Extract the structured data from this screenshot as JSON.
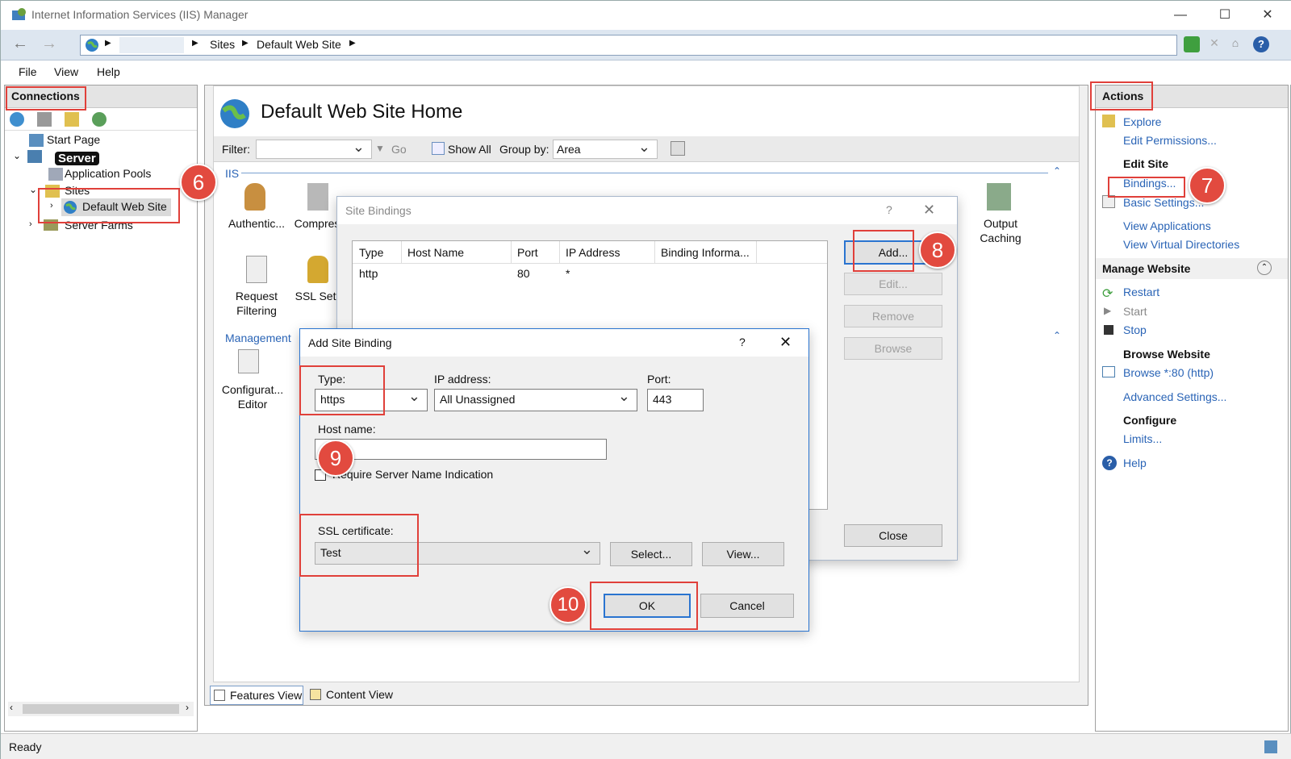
{
  "window": {
    "title": "Internet Information Services (IIS) Manager"
  },
  "address": {
    "crumbs": [
      "Sites",
      "Default Web Site"
    ]
  },
  "menu": [
    "File",
    "View",
    "Help"
  ],
  "connections": {
    "header": "Connections",
    "tree": {
      "start_page": "Start Page",
      "server": "Server",
      "app_pools": "Application Pools",
      "sites": "Sites",
      "default_site": "Default Web Site",
      "server_farms": "Server Farms"
    }
  },
  "center": {
    "title": "Default Web Site Home",
    "filter": {
      "label": "Filter:",
      "go": "Go",
      "show_all": "Show All",
      "group_by_label": "Group by:",
      "group_by_value": "Area"
    },
    "sections": {
      "iis": "IIS",
      "management": "Management"
    },
    "features": [
      {
        "label1": "Authentic...",
        "label2": ""
      },
      {
        "label1": "Compres",
        "label2": ""
      },
      {
        "label1": "Output",
        "label2": "Caching"
      },
      {
        "label1": "Request",
        "label2": "Filtering"
      },
      {
        "label1": "SSL Sett",
        "label2": ""
      },
      {
        "label1": "Configurat...",
        "label2": "Editor"
      }
    ],
    "views": {
      "features": "Features View",
      "content": "Content View"
    }
  },
  "actions": {
    "header": "Actions",
    "explore": "Explore",
    "edit_permissions": "Edit Permissions...",
    "edit_site": "Edit Site",
    "bindings": "Bindings...",
    "basic_settings": "Basic Settings...",
    "view_applications": "View Applications",
    "view_vdirs": "View Virtual Directories",
    "manage_website": "Manage Website",
    "restart": "Restart",
    "start": "Start",
    "stop": "Stop",
    "browse_website": "Browse Website",
    "browse_80": "Browse *:80 (http)",
    "advanced_settings": "Advanced Settings...",
    "configure": "Configure",
    "limits": "Limits...",
    "help": "Help"
  },
  "site_bindings": {
    "title": "Site Bindings",
    "help": "?",
    "columns": [
      "Type",
      "Host Name",
      "Port",
      "IP Address",
      "Binding Informa..."
    ],
    "rows": [
      {
        "type": "http",
        "host": "",
        "port": "80",
        "ip": "*",
        "info": ""
      }
    ],
    "buttons": {
      "add": "Add...",
      "edit": "Edit...",
      "remove": "Remove",
      "browse": "Browse",
      "close": "Close"
    }
  },
  "add_binding": {
    "title": "Add Site Binding",
    "help": "?",
    "type_label": "Type:",
    "type_value": "https",
    "ip_label": "IP address:",
    "ip_value": "All Unassigned",
    "port_label": "Port:",
    "port_value": "443",
    "host_label": "Host name:",
    "host_value": "",
    "sni_label": "Require Server Name Indication",
    "ssl_label": "SSL certificate:",
    "ssl_value": "Test",
    "select": "Select...",
    "view": "View...",
    "ok": "OK",
    "cancel": "Cancel"
  },
  "steps": [
    "6",
    "7",
    "8",
    "9",
    "10"
  ],
  "status": {
    "text": "Ready"
  },
  "colors": {
    "annotation": "#e24a3f",
    "link": "#2a64b6"
  }
}
